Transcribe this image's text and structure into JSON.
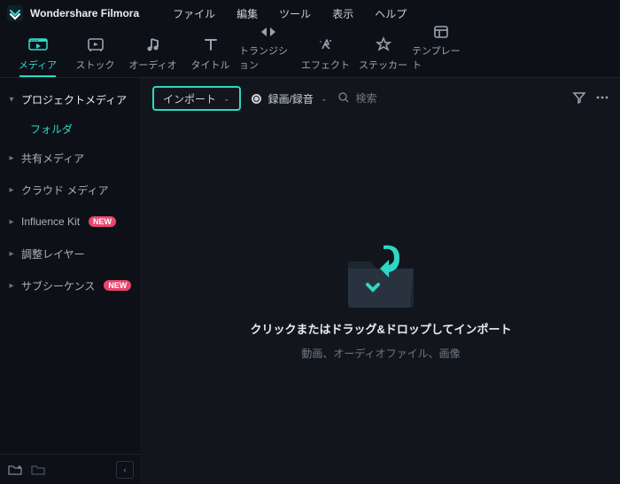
{
  "app": {
    "title": "Wondershare Filmora"
  },
  "menu": {
    "items": [
      "ファイル",
      "編集",
      "ツール",
      "表示",
      "ヘルプ"
    ]
  },
  "toolbar": {
    "tabs": [
      {
        "label": "メディア",
        "icon": "media",
        "active": true
      },
      {
        "label": "ストック",
        "icon": "stock"
      },
      {
        "label": "オーディオ",
        "icon": "audio"
      },
      {
        "label": "タイトル",
        "icon": "title"
      },
      {
        "label": "トランジション",
        "icon": "transition"
      },
      {
        "label": "エフェクト",
        "icon": "effect"
      },
      {
        "label": "ステッカー",
        "icon": "sticker"
      },
      {
        "label": "テンプレート",
        "icon": "template"
      }
    ]
  },
  "sidebar": {
    "items": [
      {
        "label": "プロジェクトメディア",
        "expanded": true,
        "children": [
          {
            "label": "フォルダ"
          }
        ]
      },
      {
        "label": "共有メディア"
      },
      {
        "label": "クラウド メディア"
      },
      {
        "label": "Influence Kit",
        "badge": "NEW"
      },
      {
        "label": "調整レイヤー"
      },
      {
        "label": "サブシーケンス",
        "badge": "NEW"
      }
    ]
  },
  "content": {
    "import_label": "インポート",
    "record_label": "録画/録音",
    "search_placeholder": "検索",
    "drop_title": "クリックまたはドラッグ&ドロップしてインポート",
    "drop_sub": "動画、オーディオファイル、画像"
  }
}
